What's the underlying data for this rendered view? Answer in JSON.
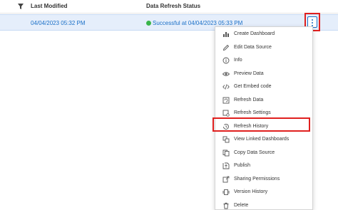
{
  "table": {
    "columns": {
      "last_modified": "Last Modified",
      "data_refresh_status": "Data Refresh Status"
    },
    "rows": [
      {
        "last_modified": "04/04/2023 05:32 PM",
        "status": "Successful at 04/04/2023 05:33 PM"
      }
    ]
  },
  "menu": {
    "items": [
      {
        "label": "Create Dashboard",
        "icon": "bar-chart-icon"
      },
      {
        "label": "Edit Data Source",
        "icon": "pencil-icon"
      },
      {
        "label": "Info",
        "icon": "info-icon"
      },
      {
        "label": "Preview Data",
        "icon": "eye-icon"
      },
      {
        "label": "Get Embed code",
        "icon": "code-icon"
      },
      {
        "label": "Refresh Data",
        "icon": "refresh-data-icon"
      },
      {
        "label": "Refresh Settings",
        "icon": "refresh-settings-icon"
      },
      {
        "label": "Refresh History",
        "icon": "history-icon"
      },
      {
        "label": "View Linked Dashboards",
        "icon": "linked-dashboards-icon"
      },
      {
        "label": "Copy Data Source",
        "icon": "copy-icon"
      },
      {
        "label": "Publish",
        "icon": "publish-icon"
      },
      {
        "label": "Sharing Permissions",
        "icon": "share-icon"
      },
      {
        "label": "Version History",
        "icon": "version-icon"
      },
      {
        "label": "Delete",
        "icon": "trash-icon"
      }
    ]
  },
  "colors": {
    "link": "#1a6fc7",
    "success": "#3ab54a",
    "highlight": "#e0201f",
    "row_selected": "#e5eefb"
  }
}
